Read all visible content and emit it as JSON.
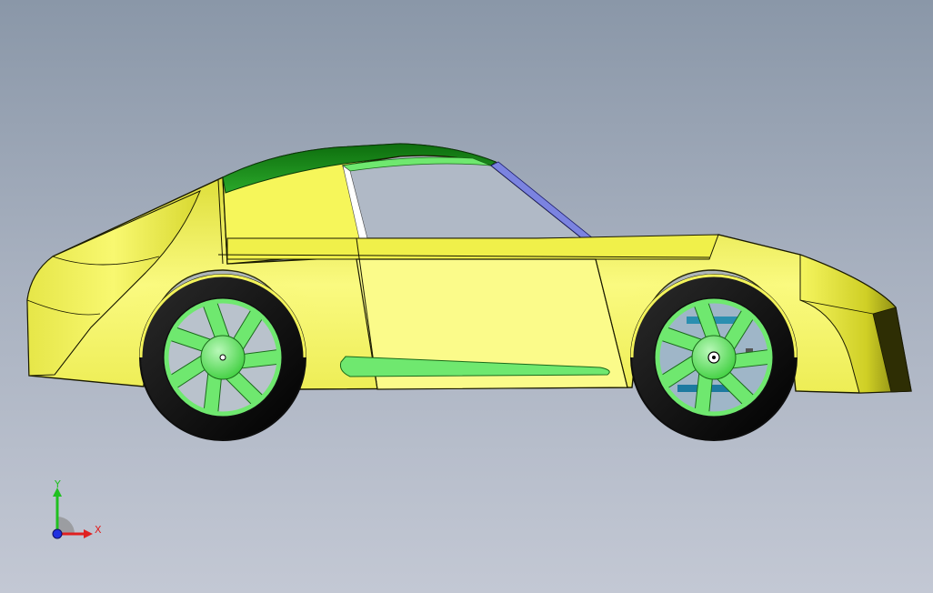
{
  "viewport": {
    "background_top": "#8a97a8",
    "background_bottom": "#c3c8d4"
  },
  "model": {
    "body_color": "#f2f250",
    "body_shadow_color": "#b8b81c",
    "rim_color": "#6fe86f",
    "glass_tint_color": "#1e8f1e",
    "rear_glass_color": "#7b83e0",
    "tire_color": "#0a0a0a",
    "wheel_count": 2,
    "spokes_per_wheel": 7
  },
  "triad": {
    "x_label": "X",
    "y_label": "Y",
    "x_color": "#e02020",
    "y_color": "#20c020",
    "z_color": "#2030e0",
    "icon": "coordinate-triad-icon"
  }
}
